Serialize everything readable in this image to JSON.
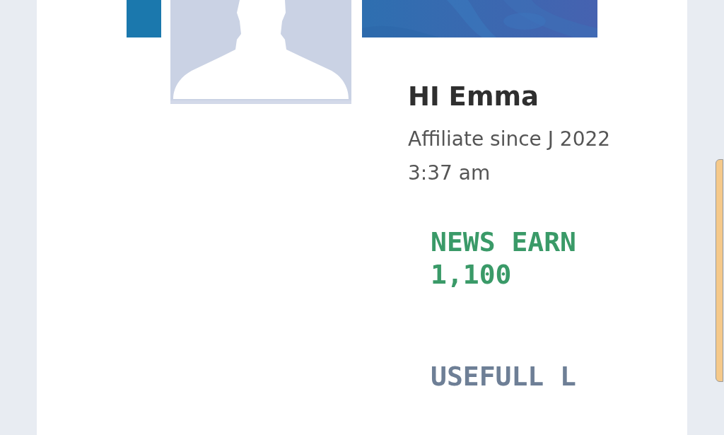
{
  "profile": {
    "greeting": "HI Emma",
    "affiliate_since": "Affiliate since J 2022 3:37 am"
  },
  "earnings": {
    "label": "NEWS EARN",
    "value": "1,100"
  },
  "links_section": {
    "title": "USEFULL L"
  }
}
